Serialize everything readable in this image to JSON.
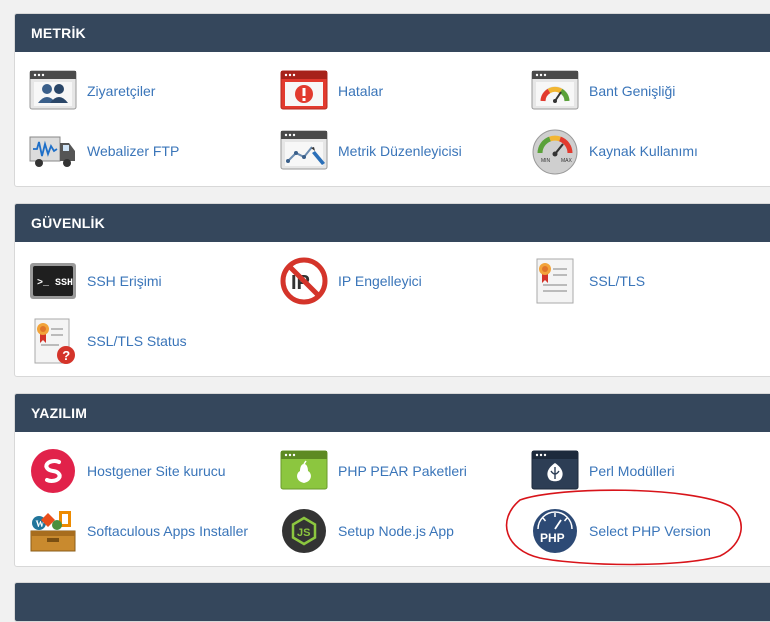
{
  "sections": {
    "metrik": {
      "title": "METRİK",
      "items": [
        "Ziyaretçiler",
        "Hatalar",
        "Bant Genişliği",
        "Webalizer FTP",
        "Metrik Düzenleyicisi",
        "Kaynak Kullanımı"
      ]
    },
    "guvenlik": {
      "title": "GÜVENLİK",
      "items": [
        "SSH Erişimi",
        "IP Engelleyici",
        "SSL/TLS",
        "SSL/TLS Status"
      ]
    },
    "yazilim": {
      "title": "YAZILIM",
      "items": [
        "Hostgener Site kurucu",
        "PHP PEAR Paketleri",
        "Perl Modülleri",
        "Softaculous Apps Installer",
        "Setup Node.js App",
        "Select PHP Version"
      ]
    }
  },
  "icon_text": {
    "ssh": ">_ SSH",
    "ip": "IP",
    "php": "PHP",
    "node": "JS",
    "gauge_min": "MIN",
    "gauge_max": "MAX"
  },
  "icons": {
    "metrik": [
      "visitors-icon",
      "errors-icon",
      "bandwidth-icon",
      "webalizer-ftp-icon",
      "metrics-editor-icon",
      "resource-usage-icon"
    ],
    "guvenlik": [
      "ssh-icon",
      "ip-blocker-icon",
      "ssl-certificate-icon",
      "ssl-status-icon"
    ],
    "yazilim": [
      "site-builder-icon",
      "php-pear-icon",
      "perl-modules-icon",
      "softaculous-icon",
      "nodejs-icon",
      "php-version-icon"
    ]
  },
  "colors": {
    "header_bg": "#35475c",
    "link": "#3a75b9",
    "annotation": "#d8141a"
  }
}
